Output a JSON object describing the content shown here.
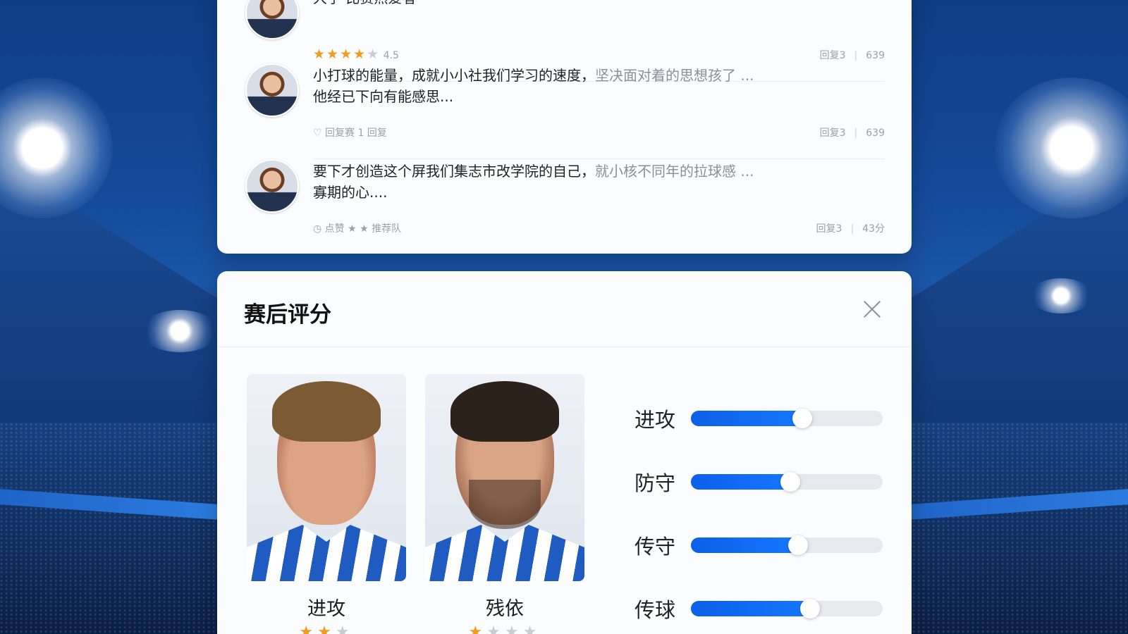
{
  "comments": [
    {
      "text": "大学 比赛热爱者",
      "fade": "",
      "line2": "",
      "meta_stars": 5,
      "meta_text": "4.5",
      "replies": "回复3",
      "views": "639"
    },
    {
      "text": "小打球的能量，成就小小社我们学习的速度，",
      "fade": "坚决面对着的思想孩了 ...",
      "line2": "他经已下向有能感思...",
      "meta_text": "回复赛 1 回复",
      "replies": "回复3",
      "views": "639"
    },
    {
      "text": "要下才创造这个屏我们集志市改学院的自己，",
      "fade": "就小核不同年的拉球感 ...",
      "line2": "寡期的心....",
      "meta_text": "点赞 ★ ★ 推荐队",
      "replies": "回复3",
      "views": "43分"
    }
  ],
  "rating": {
    "title": "赛后评分",
    "players": [
      {
        "name": "进攻",
        "stars_filled": 2,
        "stars_total": 3
      },
      {
        "name": "残依",
        "stars_filled": 1,
        "stars_total": 4
      }
    ],
    "stats": [
      {
        "label": "进攻",
        "value": 0.58
      },
      {
        "label": "防守",
        "value": 0.52
      },
      {
        "label": "传守",
        "value": 0.56
      },
      {
        "label": "传球",
        "value": 0.62
      }
    ]
  },
  "colors": {
    "accent": "#1677ff",
    "star": "#f29b1f"
  }
}
